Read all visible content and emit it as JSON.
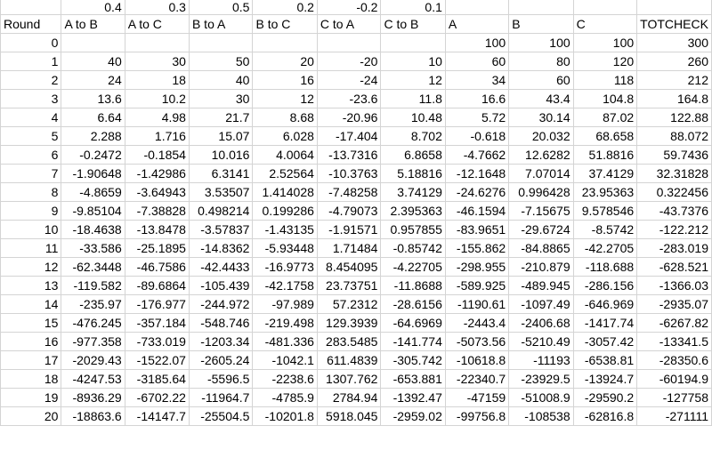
{
  "rate_row": [
    "",
    "0.4",
    "0.3",
    "0.5",
    "0.2",
    "-0.2",
    "0.1",
    "",
    "",
    "",
    ""
  ],
  "header_row": [
    "Round",
    "A to B",
    "A to C",
    "B to A",
    "B to C",
    "C to A",
    "C to B",
    "A",
    "B",
    "C",
    "TOTCHECK"
  ],
  "rows": [
    [
      "0",
      "",
      "",
      "",
      "",
      "",
      "",
      "100",
      "100",
      "100",
      "300"
    ],
    [
      "1",
      "40",
      "30",
      "50",
      "20",
      "-20",
      "10",
      "60",
      "80",
      "120",
      "260"
    ],
    [
      "2",
      "24",
      "18",
      "40",
      "16",
      "-24",
      "12",
      "34",
      "60",
      "118",
      "212"
    ],
    [
      "3",
      "13.6",
      "10.2",
      "30",
      "12",
      "-23.6",
      "11.8",
      "16.6",
      "43.4",
      "104.8",
      "164.8"
    ],
    [
      "4",
      "6.64",
      "4.98",
      "21.7",
      "8.68",
      "-20.96",
      "10.48",
      "5.72",
      "30.14",
      "87.02",
      "122.88"
    ],
    [
      "5",
      "2.288",
      "1.716",
      "15.07",
      "6.028",
      "-17.404",
      "8.702",
      "-0.618",
      "20.032",
      "68.658",
      "88.072"
    ],
    [
      "6",
      "-0.2472",
      "-0.1854",
      "10.016",
      "4.0064",
      "-13.7316",
      "6.8658",
      "-4.7662",
      "12.6282",
      "51.8816",
      "59.7436"
    ],
    [
      "7",
      "-1.90648",
      "-1.42986",
      "6.3141",
      "2.52564",
      "-10.3763",
      "5.18816",
      "-12.1648",
      "7.07014",
      "37.4129",
      "32.31828"
    ],
    [
      "8",
      "-4.8659",
      "-3.64943",
      "3.53507",
      "1.414028",
      "-7.48258",
      "3.74129",
      "-24.6276",
      "0.996428",
      "23.95363",
      "0.322456"
    ],
    [
      "9",
      "-9.85104",
      "-7.38828",
      "0.498214",
      "0.199286",
      "-4.79073",
      "2.395363",
      "-46.1594",
      "-7.15675",
      "9.578546",
      "-43.7376"
    ],
    [
      "10",
      "-18.4638",
      "-13.8478",
      "-3.57837",
      "-1.43135",
      "-1.91571",
      "0.957855",
      "-83.9651",
      "-29.6724",
      "-8.5742",
      "-122.212"
    ],
    [
      "11",
      "-33.586",
      "-25.1895",
      "-14.8362",
      "-5.93448",
      "1.71484",
      "-0.85742",
      "-155.862",
      "-84.8865",
      "-42.2705",
      "-283.019"
    ],
    [
      "12",
      "-62.3448",
      "-46.7586",
      "-42.4433",
      "-16.9773",
      "8.454095",
      "-4.22705",
      "-298.955",
      "-210.879",
      "-118.688",
      "-628.521"
    ],
    [
      "13",
      "-119.582",
      "-89.6864",
      "-105.439",
      "-42.1758",
      "23.73751",
      "-11.8688",
      "-589.925",
      "-489.945",
      "-286.156",
      "-1366.03"
    ],
    [
      "14",
      "-235.97",
      "-176.977",
      "-244.972",
      "-97.989",
      "57.2312",
      "-28.6156",
      "-1190.61",
      "-1097.49",
      "-646.969",
      "-2935.07"
    ],
    [
      "15",
      "-476.245",
      "-357.184",
      "-548.746",
      "-219.498",
      "129.3939",
      "-64.6969",
      "-2443.4",
      "-2406.68",
      "-1417.74",
      "-6267.82"
    ],
    [
      "16",
      "-977.358",
      "-733.019",
      "-1203.34",
      "-481.336",
      "283.5485",
      "-141.774",
      "-5073.56",
      "-5210.49",
      "-3057.42",
      "-13341.5"
    ],
    [
      "17",
      "-2029.43",
      "-1522.07",
      "-2605.24",
      "-1042.1",
      "611.4839",
      "-305.742",
      "-10618.8",
      "-11193",
      "-6538.81",
      "-28350.6"
    ],
    [
      "18",
      "-4247.53",
      "-3185.64",
      "-5596.5",
      "-2238.6",
      "1307.762",
      "-653.881",
      "-22340.7",
      "-23929.5",
      "-13924.7",
      "-60194.9"
    ],
    [
      "19",
      "-8936.29",
      "-6702.22",
      "-11964.7",
      "-4785.9",
      "2784.94",
      "-1392.47",
      "-47159",
      "-51008.9",
      "-29590.2",
      "-127758"
    ],
    [
      "20",
      "-18863.6",
      "-14147.7",
      "-25504.5",
      "-10201.8",
      "5918.045",
      "-2959.02",
      "-99756.8",
      "-108538",
      "-62816.8",
      "-271111"
    ]
  ]
}
